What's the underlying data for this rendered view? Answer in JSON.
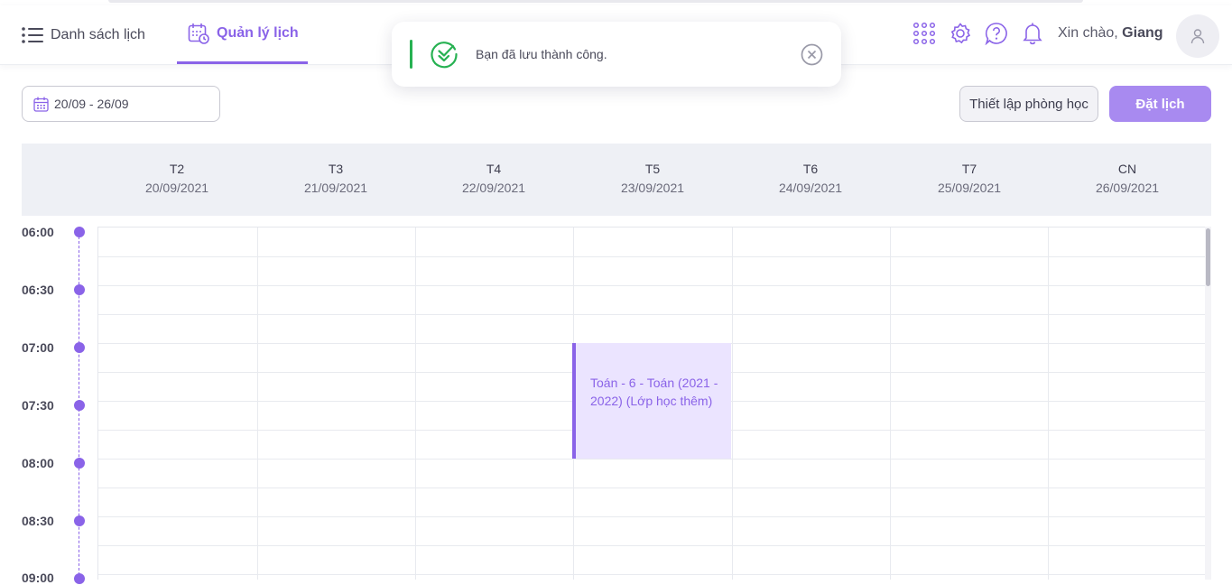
{
  "nav": {
    "list_label": "Danh sách lịch",
    "manage_label": "Quản lý lịch"
  },
  "header": {
    "greeting": "Xin chào,",
    "user_name": "Giang",
    "icons": [
      "apps-grid-icon",
      "settings-icon",
      "help-icon",
      "bell-icon"
    ]
  },
  "toast": {
    "message": "Bạn đã lưu thành công.",
    "status_color": "#27b152"
  },
  "toolbar": {
    "date_range": "20/09 - 26/09",
    "room_setup_label": "Thiết lập phòng học",
    "book_label": "Đặt lịch"
  },
  "calendar": {
    "days": [
      {
        "name": "T2",
        "date": "20/09/2021"
      },
      {
        "name": "T3",
        "date": "21/09/2021"
      },
      {
        "name": "T4",
        "date": "22/09/2021"
      },
      {
        "name": "T5",
        "date": "23/09/2021"
      },
      {
        "name": "T6",
        "date": "24/09/2021"
      },
      {
        "name": "T7",
        "date": "25/09/2021"
      },
      {
        "name": "CN",
        "date": "26/09/2021"
      }
    ],
    "times": [
      "06:00",
      "06:30",
      "07:00",
      "07:30",
      "08:00",
      "08:30",
      "09:00"
    ],
    "events": [
      {
        "title": "Toán - 6 - Toán (2021 - 2022) (Lớp học thêm)",
        "day": "T5",
        "start": "07:00",
        "end": "08:00"
      }
    ]
  },
  "colors": {
    "accent": "#8a63e8",
    "primary_button": "#a88af0",
    "event_bg": "#ebe4ff",
    "header_bg": "#eef0f5"
  }
}
